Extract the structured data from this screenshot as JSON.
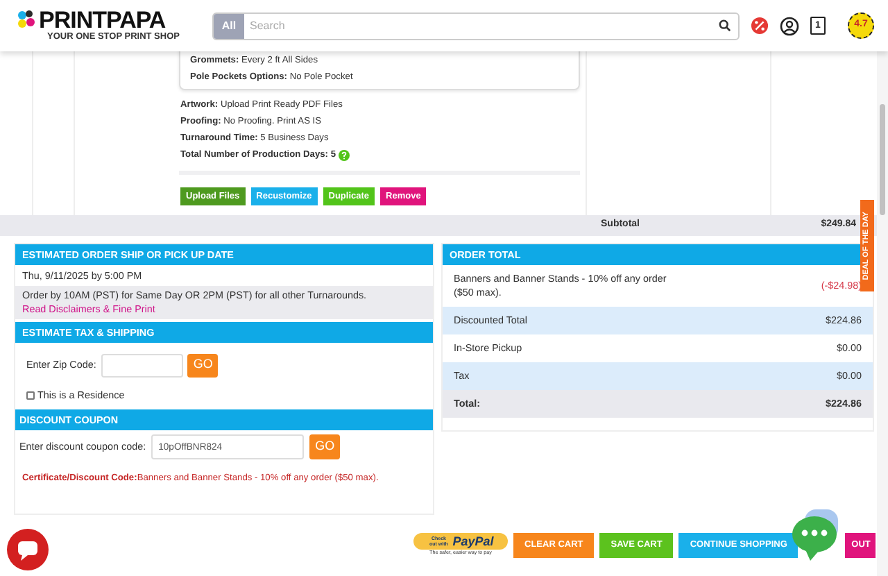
{
  "header": {
    "logo": "PRINTPAPA",
    "tagline": "YOUR ONE STOP PRINT SHOP",
    "search": {
      "scope": "All",
      "placeholder": "Search"
    },
    "cart_count": "1",
    "rating": "4.7"
  },
  "item": {
    "options": [
      {
        "label": "Grommets:",
        "value": "Every 2 ft All Sides"
      },
      {
        "label": "Pole Pockets Options:",
        "value": "No Pole Pocket"
      }
    ],
    "details": [
      {
        "label": "Artwork:",
        "value": "Upload Print Ready PDF Files"
      },
      {
        "label": "Proofing:",
        "value": "No Proofing. Print AS IS"
      },
      {
        "label": "Turnaround Time:",
        "value": "5 Business Days"
      }
    ],
    "production_days": {
      "label": "Total Number of Production Days:",
      "value": "5"
    },
    "actions": [
      {
        "label": "Upload Files",
        "color": "#4e9a1f"
      },
      {
        "label": "Recustomize",
        "color": "#1ab0ea"
      },
      {
        "label": "Duplicate",
        "color": "#52c41a"
      },
      {
        "label": "Remove",
        "color": "#e0147c"
      }
    ]
  },
  "subtotal": {
    "label": "Subtotal",
    "value": "$249.84"
  },
  "ship_date": {
    "title": "ESTIMATED ORDER SHIP OR PICK UP DATE",
    "date": "Thu, 9/11/2025 by 5:00 PM",
    "note": "Order by 10AM (PST) for Same Day OR 2PM (PST) for all other Turnarounds.",
    "link": "Read Disclaimers & Fine Print"
  },
  "tax": {
    "title": "ESTIMATE TAX & SHIPPING",
    "zip_label": "Enter Zip Code:",
    "go": "GO",
    "residence": {
      "label": "This is a Residence",
      "checked": false
    }
  },
  "coupon": {
    "title": "DISCOUNT COUPON",
    "label": "Enter discount coupon code:",
    "value": "10pOffBNR824",
    "go": "GO",
    "note_label": "Certificate/Discount Code:",
    "note_text": "Banners and Banner Stands - 10% off any order ($50 max)."
  },
  "order_total": {
    "title": "ORDER TOTAL",
    "rows": [
      {
        "kind": "discount",
        "label": "Banners and Banner Stands - 10% off any order ($50 max).",
        "value": "(-$24.98)"
      },
      {
        "kind": "line",
        "label": "Discounted Total",
        "value": "$224.86"
      },
      {
        "kind": "line",
        "label": "In-Store Pickup",
        "value": "$0.00"
      },
      {
        "kind": "line",
        "label": "Tax",
        "value": "$0.00"
      },
      {
        "kind": "total",
        "label": "Total:",
        "value": "$224.86"
      }
    ]
  },
  "paypal": {
    "top": "Check out with",
    "brand": "PayPal",
    "tagline": "The safer, easier way to pay"
  },
  "footer_buttons": [
    {
      "label": "CLEAR CART",
      "color": "#f7861c"
    },
    {
      "label": "SAVE CART",
      "color": "#5cc21e"
    },
    {
      "label": "CONTINUE SHOPPING",
      "color": "#1ab0ea"
    },
    {
      "label": "OUT",
      "color": "#e0147c"
    }
  ],
  "deal_tab": "DEAL OF THE DAY"
}
